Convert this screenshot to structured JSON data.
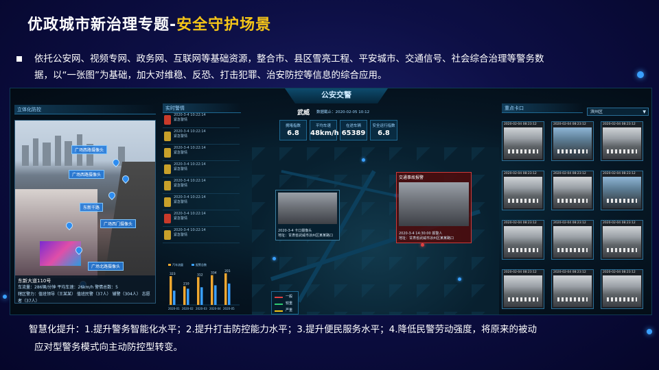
{
  "title": {
    "main": "优政城市新治理专题-",
    "sub": "安全守护场景"
  },
  "bullet": {
    "line1": "依托公安网、视频专网、政务网、互联网等基础资源，整合市、县区雪亮工程、平安城市、交通信号、社会综合治理等警务数",
    "line2": "据，以“一张图”为基础，加大对维稳、反恐、打击犯罪、治安防控等信息的综合应用。"
  },
  "dashboard": {
    "title": "公安交警",
    "left_panel_title": "立体化防控",
    "alerts_panel_title": "实时警情",
    "cams_panel_title": "重点卡口",
    "region": "滨州区",
    "city_label": "武威",
    "date_label": "数据截止：2020-02-05 10:12",
    "stats": [
      {
        "label": "拥堵指数",
        "value": "6.8"
      },
      {
        "label": "平均车速",
        "value": "48km/h"
      },
      {
        "label": "在途车辆",
        "value": "65389"
      },
      {
        "label": "安全运行指数",
        "value": "6.8"
      }
    ],
    "camera_labels": [
      "广场西路摄像头",
      "广场西路摄像头",
      "东新千路",
      "广场西门摄像头",
      "广场北路摄像头"
    ],
    "photo_info": {
      "name": "东新大道110号",
      "line1": "车流量：286辆/分钟   平均车速：26km/h   警情总数：5",
      "line2": "辖区警力：值班领导（王某某）  值班民警（37人）  辅警（304人）  志愿者（37人）"
    },
    "alert_items": [
      {
        "time": "2020-3-4 10:22:14",
        "type": "紧急警情"
      },
      {
        "time": "2020-3-4 10:22:14",
        "type": "紧急警情"
      },
      {
        "time": "2020-3-4 10:22:14",
        "type": "紧急警情"
      },
      {
        "time": "2020-3-4 10:22:14",
        "type": "紧急警情"
      },
      {
        "time": "2020-3-4 10:22:14",
        "type": "紧急警情"
      },
      {
        "time": "2020-3-4 10:22:14",
        "type": "紧急警情"
      },
      {
        "time": "2020-3-4 10:22:14",
        "type": "紧急警情"
      },
      {
        "time": "2020-3-4 10:22:14",
        "type": "紧急警情"
      }
    ],
    "popup_left": {
      "footer1": "2020-3-4  卡口摄像头",
      "footer2": "地址：甘肃省武威市凉州区某某路口"
    },
    "popup_right": {
      "header": "交通事故报警",
      "footer1": "2020-3-4  14:30:00  报警人",
      "footer2": "地址：甘肃省武威市凉州区某某路口"
    },
    "legend": [
      "一般",
      "较重",
      "严重"
    ],
    "cam_timestamp": "2020-02-04 08:23:12"
  },
  "chart_data": {
    "type": "bar",
    "series": [
      {
        "name": "汽车流量",
        "values": [
          323,
          210,
          312,
          334,
          355
        ]
      },
      {
        "name": "报警总数",
        "values": [
          160,
          182,
          198,
          220,
          240
        ]
      }
    ],
    "categories": [
      "2020-01",
      "2020-02",
      "2020-03",
      "2020-04",
      "2020-05"
    ],
    "bar_labels": [
      "323",
      "210",
      "312",
      "334",
      "355"
    ]
  },
  "footer": {
    "line1": "智慧化提升：1.提升警务智能化水平；2.提升打击防控能力水平；3.提升便民服务水平；4.降低民警劳动强度，将原来的被动",
    "line2": "应对型警务模式向主动防控型转变。"
  }
}
